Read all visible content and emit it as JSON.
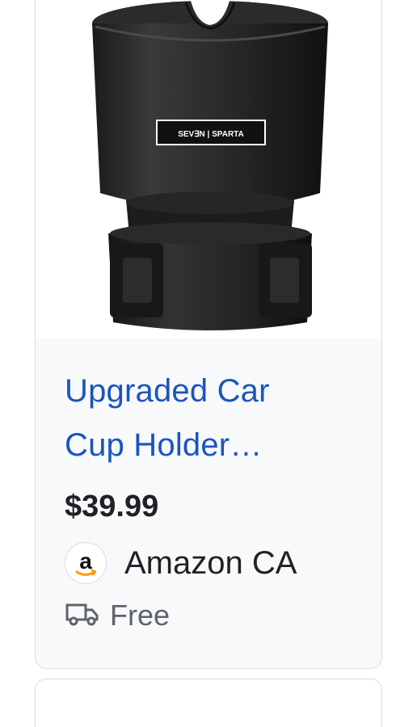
{
  "product": {
    "title_line1": "Upgraded Car",
    "title_line2": "Cup Holder…",
    "price": "$39.99",
    "brand_text": "SEV∃N | SPARTA",
    "seller": {
      "name": "Amazon CA",
      "logo_letter": "a"
    },
    "shipping": {
      "label": "Free",
      "icon": "truck-icon"
    }
  },
  "colors": {
    "title_link": "#1a55c0",
    "card_bg": "#f8f9fa",
    "amazon_orange": "#ff9900"
  }
}
